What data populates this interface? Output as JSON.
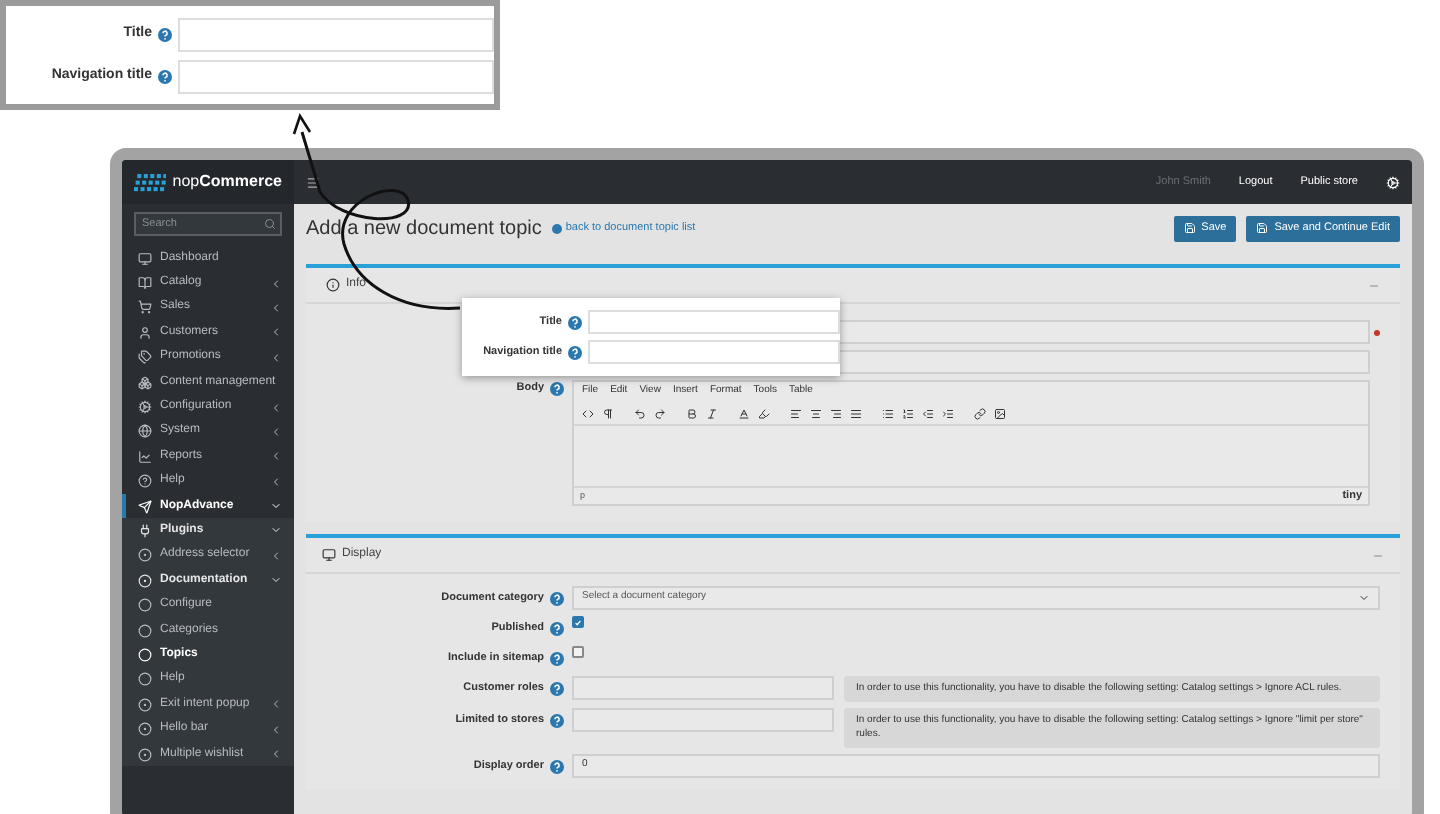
{
  "callout": {
    "fields": [
      {
        "label": "Title"
      },
      {
        "label": "Navigation title"
      }
    ]
  },
  "header": {
    "user": "John Smith",
    "links": [
      "Logout",
      "Public store"
    ]
  },
  "sidebar": {
    "logo": {
      "prefix": "nop",
      "name": "Commerce"
    },
    "search": {
      "placeholder": "Search"
    },
    "items": [
      {
        "label": "Dashboard",
        "selected": false
      },
      {
        "label": "Catalog",
        "selected": false,
        "expanded": false
      },
      {
        "label": "Sales",
        "selected": false,
        "expanded": false
      },
      {
        "label": "Customers",
        "selected": false,
        "expanded": false
      },
      {
        "label": "Promotions",
        "selected": false,
        "expanded": false
      },
      {
        "label": "Content management",
        "selected": false,
        "expanded": false
      },
      {
        "label": "Configuration",
        "selected": false,
        "expanded": false
      },
      {
        "label": "System",
        "selected": false,
        "expanded": false
      },
      {
        "label": "Reports",
        "selected": false,
        "expanded": false
      },
      {
        "label": "Help",
        "selected": false,
        "expanded": false
      },
      {
        "label": "NopAdvance",
        "selected": true,
        "expanded": true,
        "children": [
          {
            "label": "Plugins",
            "selected": false,
            "expanded": true,
            "children": [
              {
                "label": "Address selector",
                "selected": false,
                "expanded": false
              },
              {
                "label": "Documentation",
                "selected": false,
                "expanded": true,
                "children": [
                  {
                    "label": "Configure",
                    "selected": false
                  },
                  {
                    "label": "Categories",
                    "selected": false
                  },
                  {
                    "label": "Topics",
                    "selected": true
                  },
                  {
                    "label": "Help",
                    "selected": false
                  }
                ]
              },
              {
                "label": "Exit intent popup",
                "selected": false,
                "expanded": false
              },
              {
                "label": "Hello bar",
                "selected": false,
                "expanded": false
              },
              {
                "label": "Multiple wishlist",
                "selected": false,
                "expanded": false
              }
            ]
          }
        ]
      }
    ]
  },
  "page": {
    "title": "Add a new document topic",
    "back_link": "back to document topic list",
    "buttons": [
      "Save",
      "Save and Continue Edit"
    ]
  },
  "info_panel": {
    "title": "Info",
    "body_label": "Body",
    "editor": {
      "menu": [
        "File",
        "Edit",
        "View",
        "Insert",
        "Format",
        "Tools",
        "Table"
      ],
      "path": "p",
      "brand": "tiny"
    }
  },
  "highlight": {
    "fields": [
      {
        "label": "Title"
      },
      {
        "label": "Navigation title"
      }
    ]
  },
  "display_panel": {
    "title": "Display",
    "fields": [
      {
        "kind": "select",
        "label": "Document category",
        "value": "Select a document category"
      },
      {
        "kind": "checkbox",
        "label": "Published",
        "checked": true
      },
      {
        "kind": "checkbox",
        "label": "Include in sitemap",
        "checked": false
      },
      {
        "kind": "restricted",
        "label": "Customer roles",
        "note": "In order to use this functionality, you have to disable the following setting: Catalog settings > Ignore ACL rules."
      },
      {
        "kind": "restricted",
        "label": "Limited to stores",
        "note": "In order to use this functionality, you have to disable the following setting: Catalog settings > Ignore \"limit per store\" rules."
      },
      {
        "kind": "number",
        "label": "Display order",
        "value": "0"
      }
    ]
  }
}
